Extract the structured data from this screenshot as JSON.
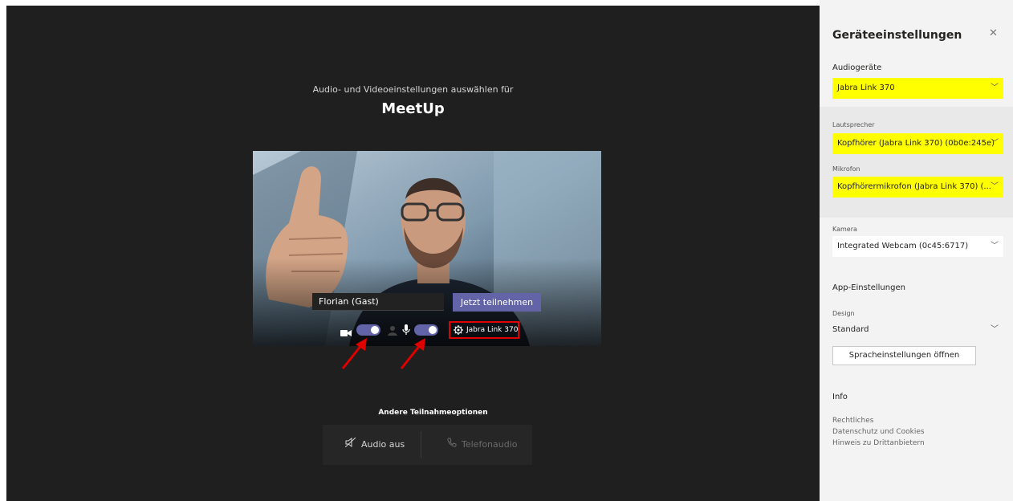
{
  "meeting": {
    "subtitle": "Audio- und Videoeinstellungen auswählen für",
    "title": "MeetUp"
  },
  "preview": {
    "name_value": "Florian (Gast)",
    "join_label": "Jetzt teilnehmen",
    "device_label": "Jabra Link 370",
    "camera_on": true,
    "mic_on": true
  },
  "other_options": {
    "title": "Andere Teilnahmeoptionen",
    "audio_off": "Audio aus",
    "phone_audio": "Telefonaudio"
  },
  "panel": {
    "title": "Geräteeinstellungen",
    "audio_devices_label": "Audiogeräte",
    "audio_device_value": "Jabra Link 370",
    "speaker_label": "Lautsprecher",
    "speaker_value": "Kopfhörer (Jabra Link 370) (0b0e:245e)",
    "mic_label": "Mikrofon",
    "mic_value": "Kopfhörermikrofon (Jabra Link 370) (...",
    "camera_label": "Kamera",
    "camera_value": "Integrated Webcam (0c45:6717)",
    "app_settings_label": "App-Einstellungen",
    "design_label": "Design",
    "design_value": "Standard",
    "language_button": "Spracheinstellungen öffnen",
    "info_label": "Info",
    "links": [
      "Rechtliches",
      "Datenschutz und Cookies",
      "Hinweis zu Drittanbietern"
    ]
  },
  "colors": {
    "accent": "#6264a7",
    "highlight": "#ffff00",
    "annotation": "#e00000"
  }
}
